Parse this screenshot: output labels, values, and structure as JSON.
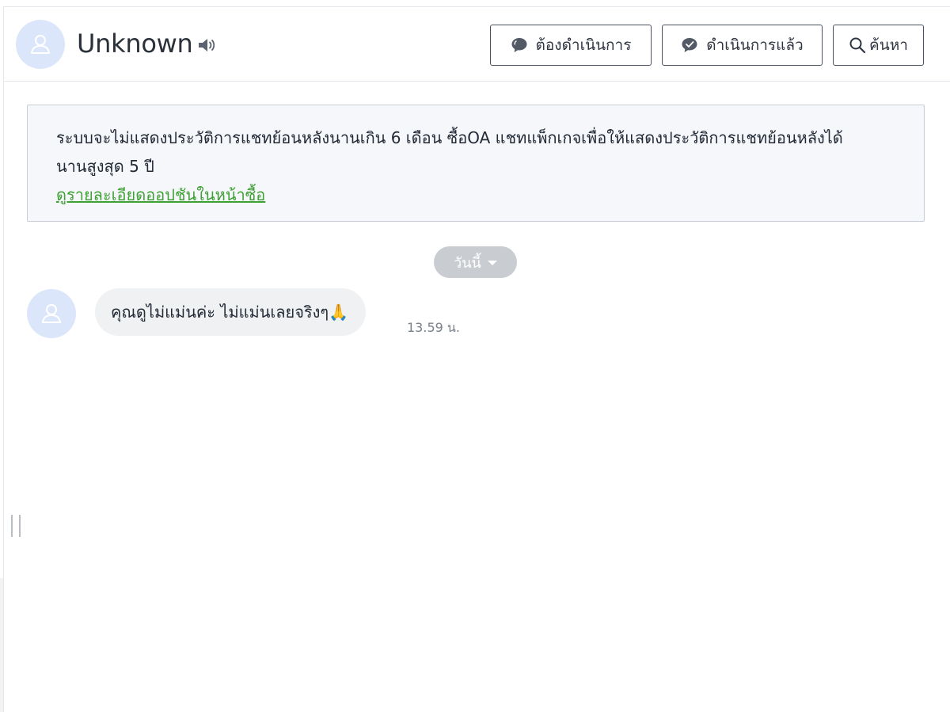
{
  "header": {
    "contact_name": "Unknown",
    "avatar_icon": "user-icon",
    "speaker_icon": "speaker-icon",
    "buttons": {
      "todo_label": "ต้องดำเนินการ",
      "todo_icon": "chat-bubble-icon",
      "done_label": "ดำเนินการแล้ว",
      "done_icon": "chat-check-icon",
      "search_label": "ค้นหา",
      "search_icon": "search-icon"
    }
  },
  "notice": {
    "line1": "ระบบจะไม่แสดงประวัติการแชทย้อนหลังนานเกิน 6 เดือน ซื้อOA แชทแพ็กเกจเพื่อให้แสดงประวัติการแชทย้อนหลังได้",
    "line2": "นานสูงสุด 5 ปี",
    "link": "ดูรายละเอียดออปชันในหน้าซื้อ"
  },
  "date_separator": {
    "label": "วันนี้",
    "icon": "caret-down-icon"
  },
  "messages": [
    {
      "text": "คุณดูไม่แม่นค่ะ ไม่แม่นเลยจริงๆ🙏",
      "time": "13.59 น.",
      "avatar_icon": "user-icon"
    }
  ],
  "colors": {
    "avatar_bg": "#dce6fb",
    "link": "#3fa035",
    "bubble_bg": "#f0f1f3",
    "date_pill_bg": "#c9ccd1",
    "notice_bg": "#f6f7fa"
  }
}
